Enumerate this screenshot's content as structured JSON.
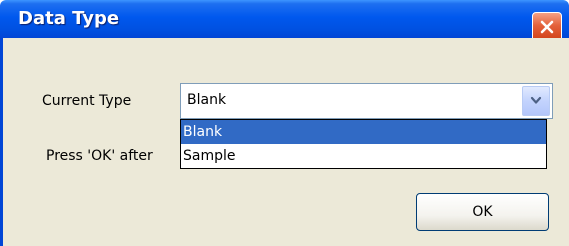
{
  "window": {
    "title": "Data Type"
  },
  "form": {
    "type_label": "Current Type",
    "hint_text": "Press 'OK' after",
    "selected_value": "Blank",
    "options": [
      "Blank",
      "Sample"
    ],
    "ok_label": "OK"
  },
  "icons": {
    "close": "close-icon",
    "dropdown": "chevron-down-icon"
  },
  "colors": {
    "titlebar": "#0058ee",
    "close_button": "#e4613a",
    "dialog_background": "#ece9d8",
    "selected_option": "#316ac5"
  }
}
